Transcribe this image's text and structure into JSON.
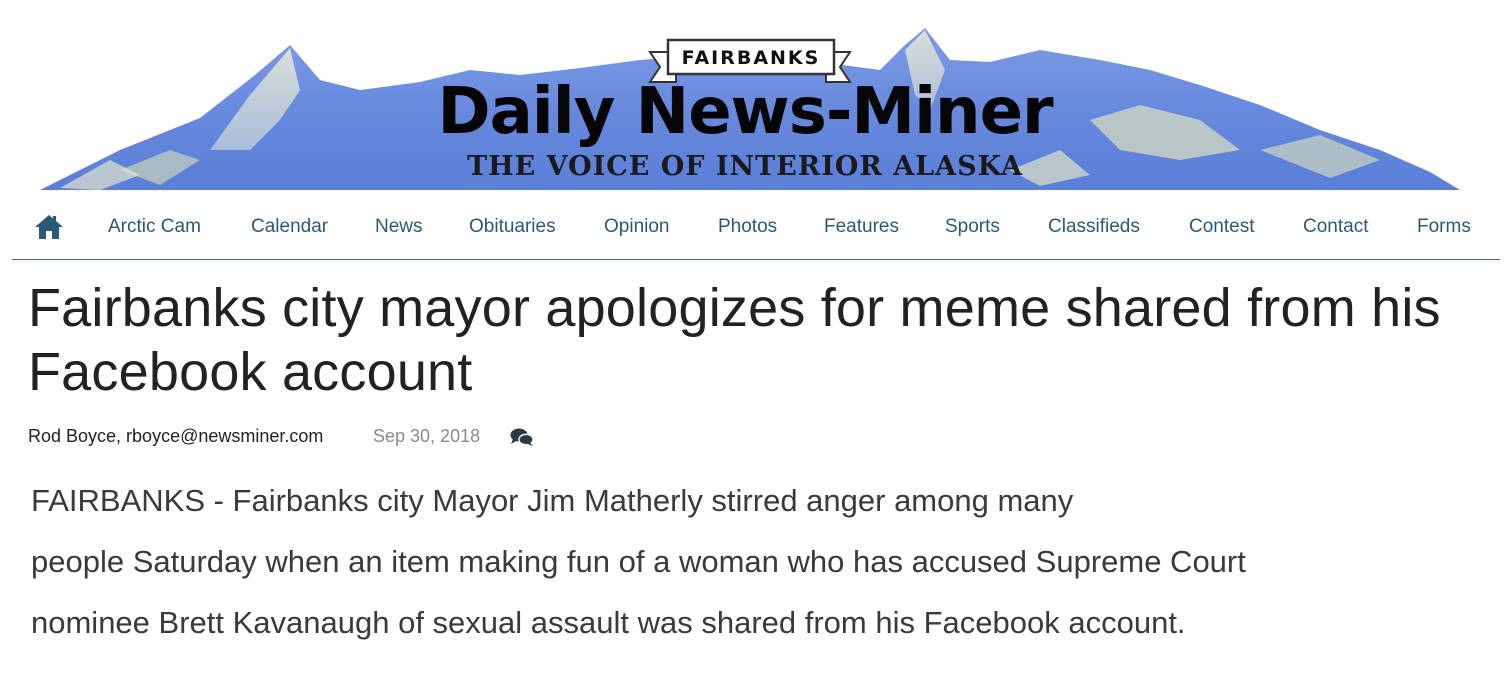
{
  "masthead": {
    "eyebrow": "FAIRBANKS",
    "title": "Daily News-Miner",
    "tagline": "THE VOICE OF INTERIOR ALASKA"
  },
  "nav": {
    "home_icon": "home-icon",
    "items": [
      "Arctic Cam",
      "Calendar",
      "News",
      "Obituaries",
      "Opinion",
      "Photos",
      "Features",
      "Sports",
      "Classifieds",
      "Contest",
      "Contact",
      "Forms"
    ]
  },
  "article": {
    "headline": "Fairbanks city mayor apologizes for meme shared from his Facebook account",
    "byline": "Rod Boyce, rboyce@newsminer.com",
    "date": "Sep 30, 2018",
    "comments_icon": "comments-icon",
    "lede_lines": [
      "FAIRBANKS - Fairbanks city Mayor Jim Matherly stirred anger among many",
      "people Saturday when an item making fun of a woman who has accused Supreme Court",
      "nominee Brett Kavanaugh of sexual assault was shared from his Facebook account."
    ]
  },
  "colors": {
    "nav_link": "#285a78",
    "nav_rule": "#3d6b85",
    "mountain_sky": "#6f8fe0",
    "headline": "#222222",
    "date": "#8a8a8a"
  }
}
